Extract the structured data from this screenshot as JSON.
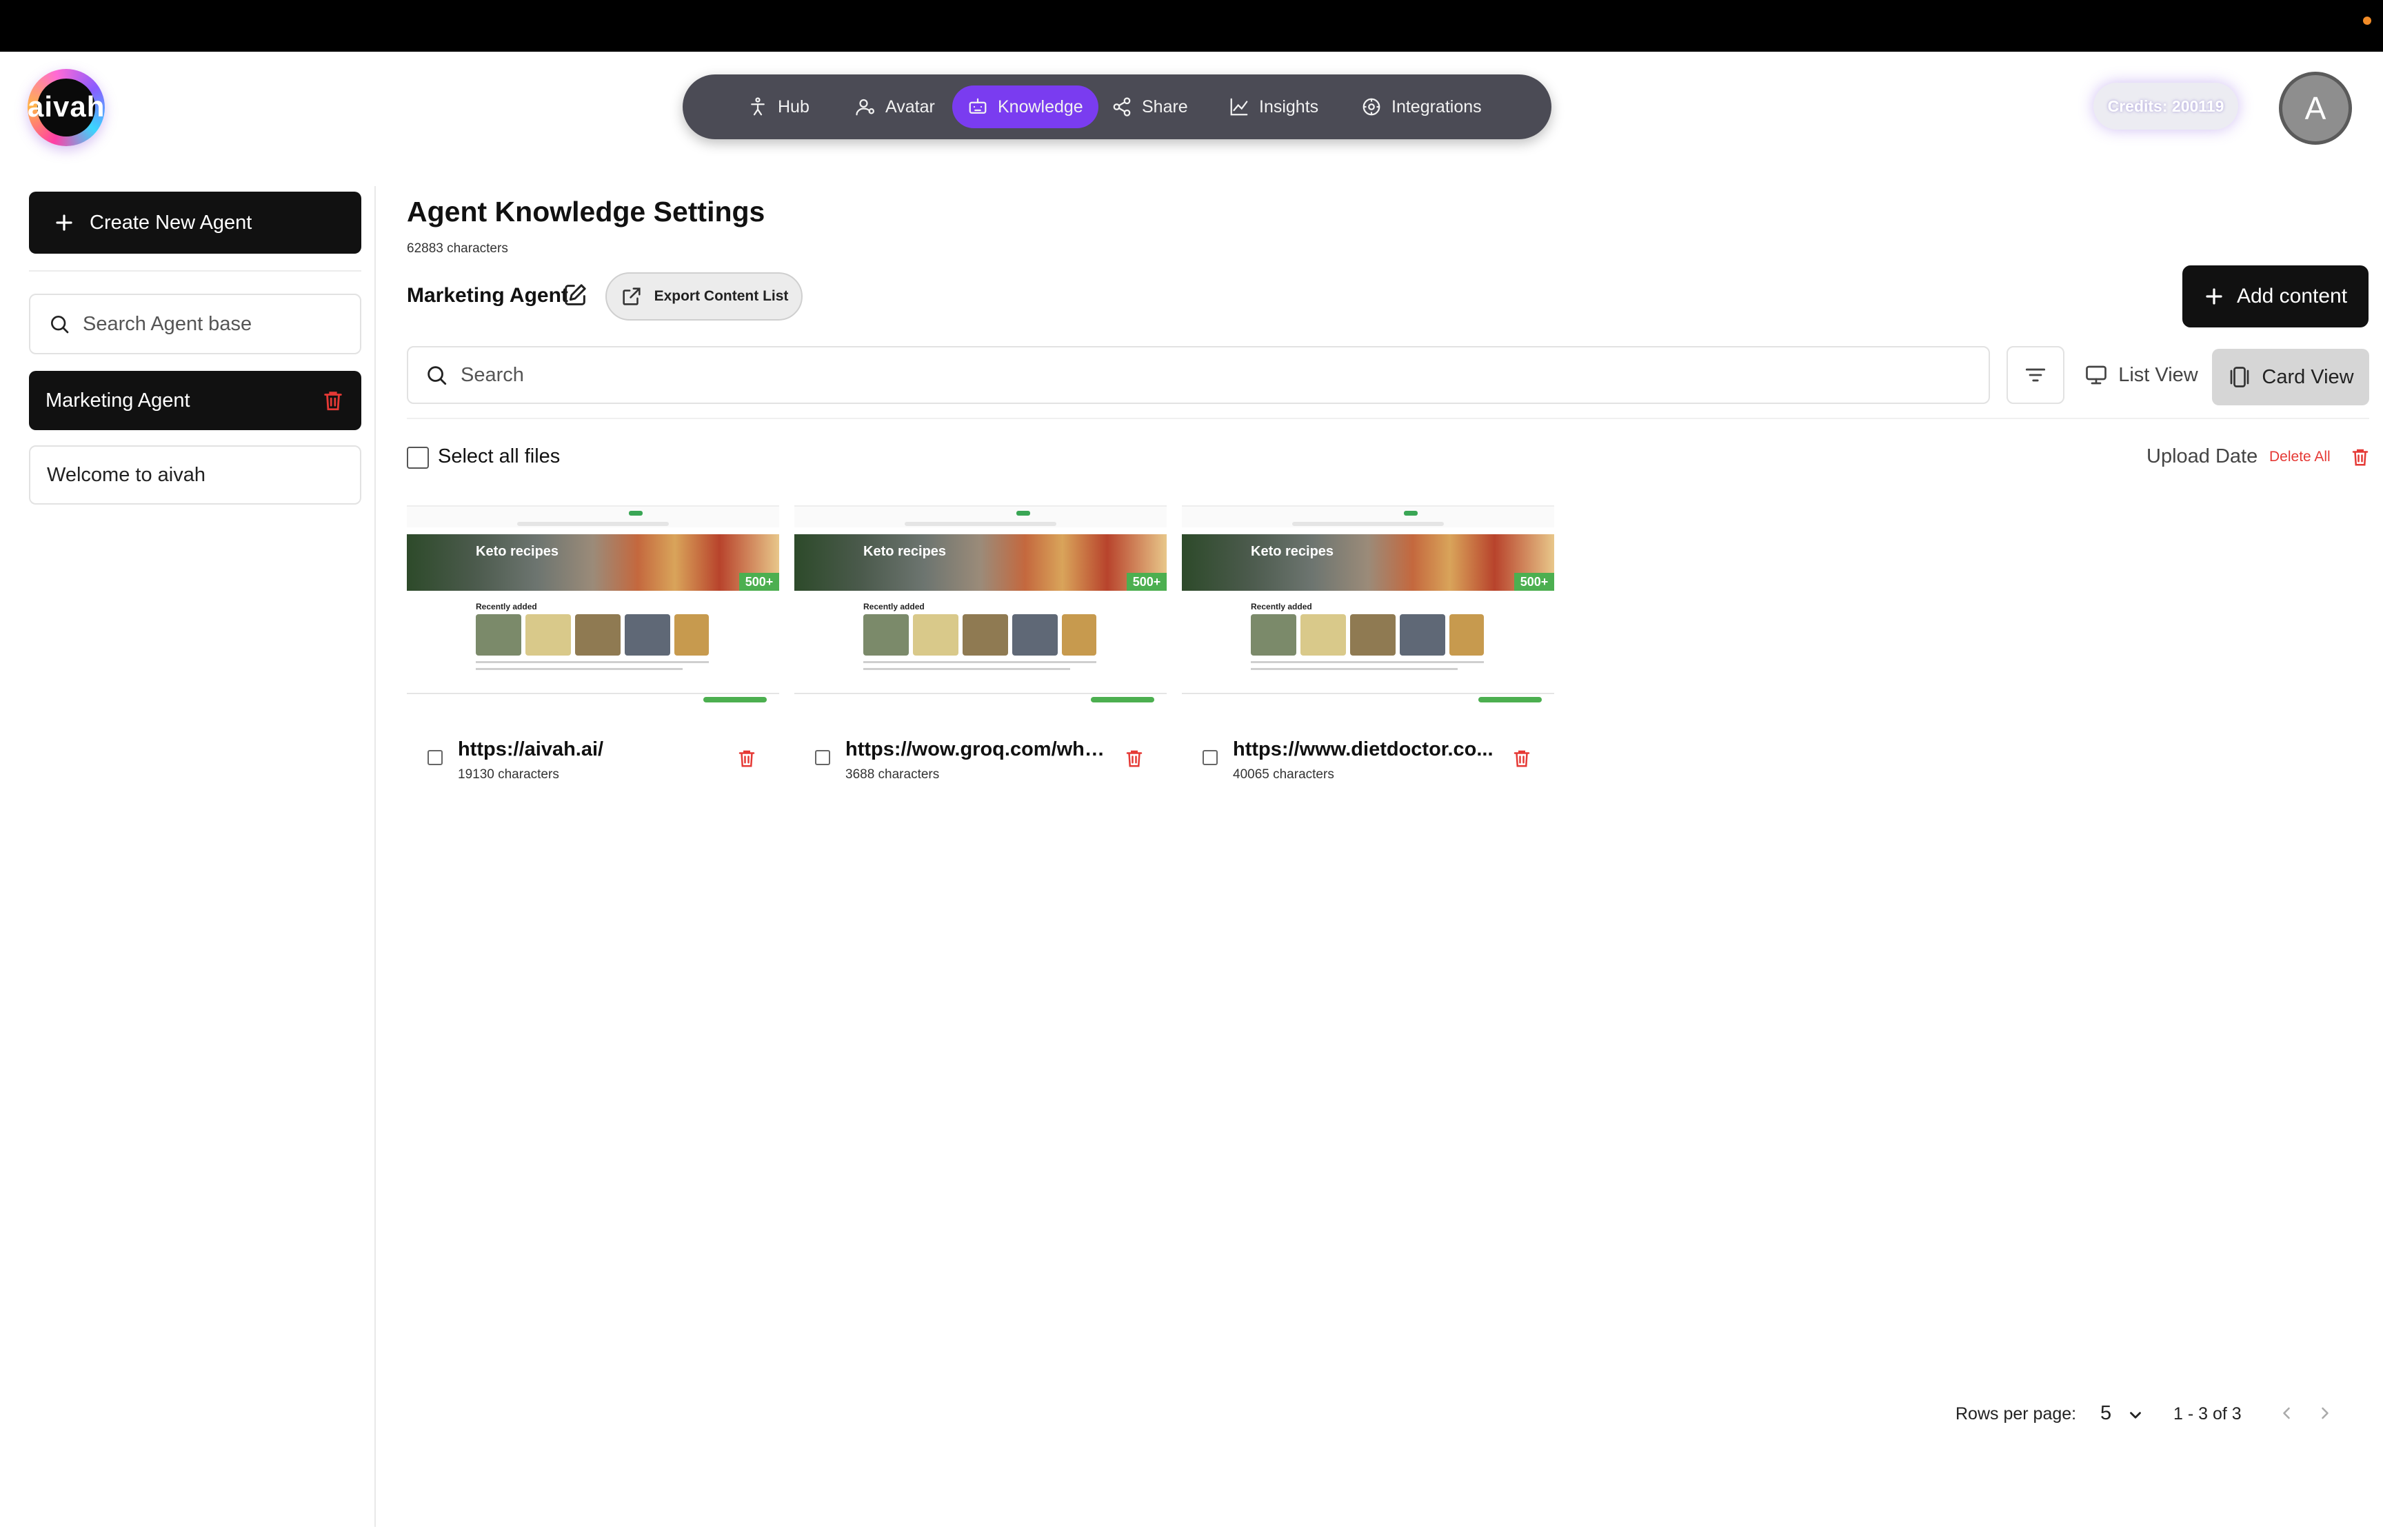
{
  "brand": {
    "logo_text": "aivah"
  },
  "nav": {
    "items": [
      {
        "label": "Hub",
        "icon": "hub-icon"
      },
      {
        "label": "Avatar",
        "icon": "avatar-icon"
      },
      {
        "label": "Knowledge",
        "icon": "knowledge-icon",
        "active": true
      },
      {
        "label": "Share",
        "icon": "share-icon"
      },
      {
        "label": "Insights",
        "icon": "insights-icon"
      },
      {
        "label": "Integrations",
        "icon": "integrations-icon"
      }
    ]
  },
  "header": {
    "credits": "Credits: 200119",
    "avatar_letter": "A"
  },
  "sidebar": {
    "create_label": "Create New Agent",
    "search_placeholder": "Search Agent base",
    "agents": [
      {
        "label": "Marketing Agent",
        "selected": true
      },
      {
        "label": "Welcome to aivah",
        "selected": false
      }
    ]
  },
  "main": {
    "title": "Agent Knowledge Settings",
    "char_count": "62883 characters",
    "agent_name": "Marketing Agent",
    "export_label": "Export Content List",
    "add_content_label": "Add content",
    "search_placeholder": "Search",
    "list_view_label": "List View",
    "card_view_label": "Card View",
    "active_view": "Card View",
    "select_all_label": "Select all files",
    "sort_label": "Upload Date",
    "delete_all_label": "Delete All"
  },
  "cards": [
    {
      "title": "https://aivah.ai/",
      "subtitle": "19130 characters",
      "thumb_title": "Keto recipes",
      "thumb_badge": "500+",
      "thumb_recent": "Recently added"
    },
    {
      "title": "https://wow.groq.com/why...",
      "subtitle": "3688 characters",
      "thumb_title": "Keto recipes",
      "thumb_badge": "500+",
      "thumb_recent": "Recently added"
    },
    {
      "title": "https://www.dietdoctor.co...",
      "subtitle": "40065 characters",
      "thumb_title": "Keto recipes",
      "thumb_badge": "500+",
      "thumb_recent": "Recently added"
    }
  ],
  "pagination": {
    "rows_label": "Rows per page:",
    "rows_value": "5",
    "range": "1 - 3 of 3"
  },
  "colors": {
    "accent": "#7a3cf0",
    "danger": "#e53935",
    "primary_button": "#111111",
    "nav_bg": "#4b4b55"
  }
}
